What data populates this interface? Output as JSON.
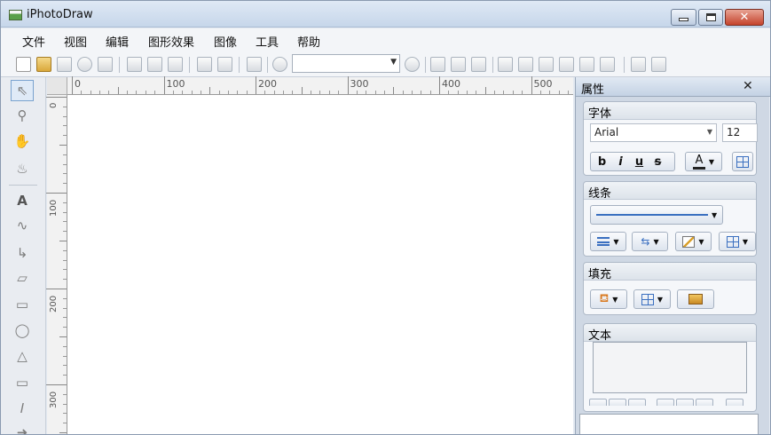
{
  "window": {
    "title": "iPhotoDraw",
    "close_glyph": "✕"
  },
  "menu": [
    "文件",
    "视图",
    "编辑",
    "图形效果",
    "图像",
    "工具",
    "帮助"
  ],
  "toolbar": {
    "icons": [
      "new-document-icon",
      "open-folder-icon",
      "save-icon",
      "globe-icon",
      "export-icon",
      "cut-icon",
      "copy-icon",
      "paste-icon",
      "undo-icon",
      "redo-icon",
      "page-icon",
      "zoom-icon",
      "zoom-combo-icon",
      "zoom-go-icon",
      "fit-page-icon",
      "fit-width-icon",
      "fit-selection-icon",
      "align-left-icon",
      "align-center-icon",
      "align-right-icon",
      "align-top-icon",
      "align-middle-icon",
      "align-bottom-icon",
      "group-icon",
      "ungroup-icon"
    ],
    "zoom_value": ""
  },
  "tools": [
    "select-tool",
    "zoom-tool",
    "pan-tool",
    "fill-tool",
    "text-tool",
    "freehand-tool",
    "connector-tool",
    "polygon-tool",
    "rectangle-tool",
    "ellipse-tool",
    "triangle-tool",
    "callout-tool",
    "text-cursor-tool",
    "arrow-tool"
  ],
  "ruler": {
    "top_labels": [
      "0",
      "100",
      "200",
      "300",
      "400",
      "500"
    ],
    "left_labels": [
      "0",
      "100",
      "200",
      "300"
    ]
  },
  "props": {
    "title": "属性",
    "close_glyph": "✕",
    "font": {
      "title": "字体",
      "family": "Arial",
      "size": "12",
      "bold": "b",
      "italic": "i",
      "underline": "u",
      "strike": "s",
      "color_letter": "A"
    },
    "line": {
      "title": "线条"
    },
    "fill": {
      "title": "填充"
    },
    "text": {
      "title": "文本"
    }
  }
}
